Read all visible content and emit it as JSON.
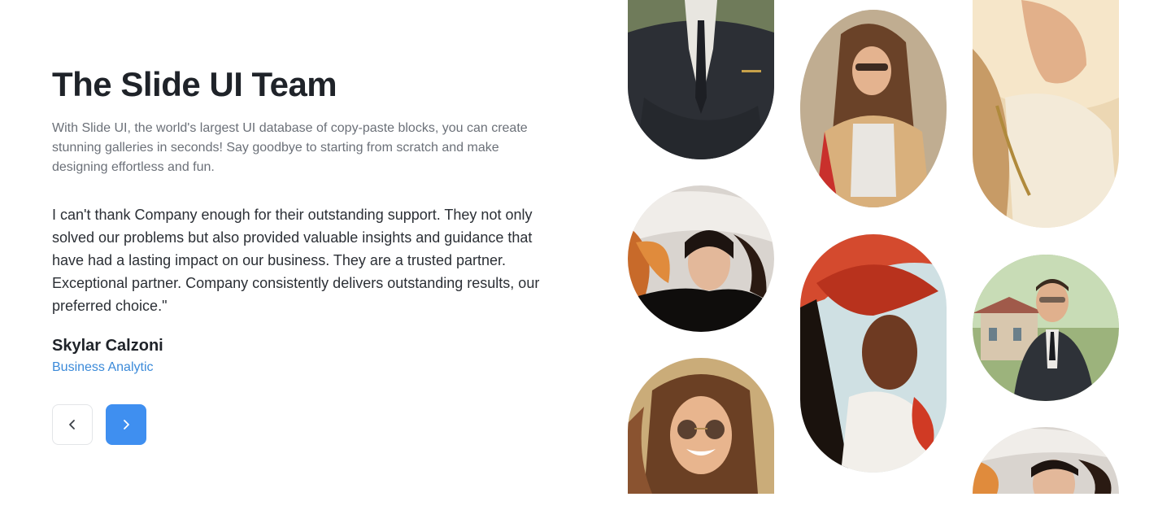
{
  "section": {
    "title": "The Slide UI Team",
    "description": "With Slide UI, the world's largest UI database of copy-paste blocks, you can create stunning galleries in seconds! Say goodbye to starting from scratch and make designing effortless and fun."
  },
  "testimonial": {
    "quote": "I can't thank Company enough for their outstanding support. They not only solved our problems but also provided valuable insights and guidance that have had a lasting impact on our business. They are a trusted partner. Exceptional partner. Company consistently delivers outstanding results, our preferred choice.\"",
    "author_name": "Skylar Calzoni",
    "author_role": "Business Analytic"
  },
  "navigation": {
    "prev_icon": "chevron-left-icon",
    "next_icon": "chevron-right-icon"
  },
  "colors": {
    "accent": "#3f8ff0",
    "role_text": "#3b8ad9",
    "heading": "#1f2329"
  }
}
